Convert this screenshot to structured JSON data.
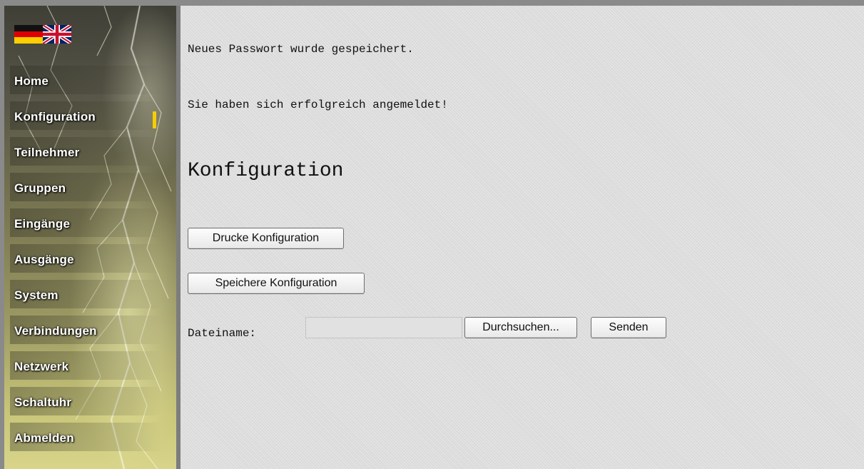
{
  "flags": {
    "german": "de-flag-icon",
    "english": "uk-flag-icon"
  },
  "sidebar": {
    "active_index": 1,
    "items": [
      {
        "label": "Home"
      },
      {
        "label": "Konfiguration"
      },
      {
        "label": "Teilnehmer"
      },
      {
        "label": "Gruppen"
      },
      {
        "label": "Eingänge"
      },
      {
        "label": "Ausgänge"
      },
      {
        "label": "System"
      },
      {
        "label": "Verbindungen"
      },
      {
        "label": "Netzwerk"
      },
      {
        "label": "Schaltuhr"
      },
      {
        "label": "Abmelden"
      }
    ]
  },
  "main": {
    "message_password": "Neues Passwort wurde gespeichert.",
    "message_login": "Sie haben sich erfolgreich angemeldet!",
    "title": "Konfiguration",
    "print_button": "Drucke Konfiguration",
    "save_button": "Speichere Konfiguration",
    "file_label": "Dateiname:",
    "file_value": "",
    "browse_button": "Durchsuchen...",
    "send_button": "Senden"
  },
  "colors": {
    "active_marker": "#f5cd00",
    "content_bg": "#dadada"
  }
}
